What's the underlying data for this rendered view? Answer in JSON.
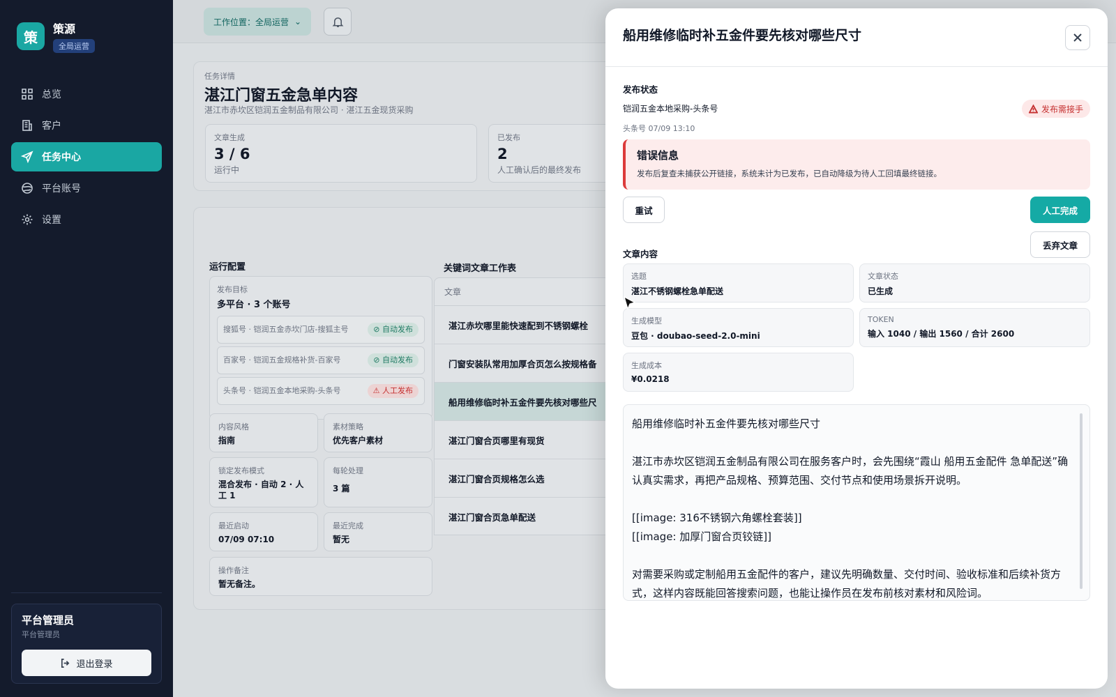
{
  "sidebar": {
    "brand_logo": "策",
    "brand_name": "策源",
    "brand_tag": "全局运营",
    "nav": [
      {
        "label": "总览",
        "icon": "grid-icon"
      },
      {
        "label": "客户",
        "icon": "building-icon"
      },
      {
        "label": "任务中心",
        "icon": "send-icon"
      },
      {
        "label": "平台账号",
        "icon": "globe-icon"
      },
      {
        "label": "设置",
        "icon": "gear-icon"
      }
    ],
    "user_name": "平台管理员",
    "user_role": "平台管理员",
    "logout": "退出登录"
  },
  "topbar": {
    "location": "工作位置：全局运营"
  },
  "detail": {
    "label": "任务详情",
    "title": "湛江门窗五金急单内容",
    "subtitle": "湛江市赤坎区铠润五金制品有限公司 · 湛江五金现货采购",
    "stats": [
      {
        "label": "文章生成",
        "value": "3 / 6",
        "note": "运行中"
      },
      {
        "label": "已发布",
        "value": "2",
        "note": "人工确认后的最终发布"
      }
    ]
  },
  "config": {
    "title": "运行配置",
    "target_label": "发布目标",
    "target_value": "多平台 · 3 个账号",
    "accounts": [
      {
        "name": "搜狐号 · 铠润五金赤坎门店-搜狐主号",
        "mode": "自动发布",
        "type": "auto"
      },
      {
        "name": "百家号 · 铠润五金规格补货-百家号",
        "mode": "自动发布",
        "type": "auto"
      },
      {
        "name": "头条号 · 铠润五金本地采购-头条号",
        "mode": "人工发布",
        "type": "manual"
      }
    ],
    "style_label": "内容风格",
    "style_value": "指南",
    "material_label": "素材策略",
    "material_value": "优先客户素材",
    "lock_label": "锁定发布模式",
    "lock_value": "混合发布 · 自动 2 · 人工 1",
    "batch_label": "每轮处理",
    "batch_value": "3 篇",
    "start_label": "最近启动",
    "start_value": "07/09 07:10",
    "finish_label": "最近完成",
    "finish_value": "暂无",
    "note_label": "操作备注",
    "note_value": "暂无备注。"
  },
  "keywords": {
    "title": "关键词文章工作表",
    "column": "文章",
    "rows": [
      "湛江赤坎哪里能快速配到不锈钢螺栓",
      "门窗安装队常用加厚合页怎么按规格备",
      "船用维修临时补五金件要先核对哪些尺",
      "湛江门窗合页哪里有现货",
      "湛江门窗合页规格怎么选",
      "湛江门窗合页急单配送"
    ]
  },
  "drawer": {
    "title": "船用维修临时补五金件要先核对哪些尺寸",
    "publish_section": "发布状态",
    "publish_account": "铠润五金本地采购-头条号",
    "publish_meta": "头条号   07/09 13:10",
    "warn_badge": "发布需接手",
    "error_title": "错误信息",
    "error_text": "发布后复查未捕获公开链接，系统未计为已发布，已自动降级为待人工回填最终链接。",
    "retry": "重试",
    "manual_done": "人工完成",
    "discard": "丢弃文章",
    "content_section": "文章内容",
    "info": [
      {
        "label": "选题",
        "value": "湛江不锈钢螺栓急单配送"
      },
      {
        "label": "文章状态",
        "value": "已生成"
      },
      {
        "label": "生成模型",
        "value": "豆包 · doubao-seed-2.0-mini"
      },
      {
        "label": "TOKEN",
        "value": "输入 1040 / 输出 1560 / 合计 2600"
      },
      {
        "label": "生成成本",
        "value": "¥0.0218"
      }
    ],
    "content_lines": [
      "船用维修临时补五金件要先核对哪些尺寸",
      "",
      "湛江市赤坎区铠润五金制品有限公司在服务客户时，会先围绕“霞山 船用五金配件 急单配送”确认真实需求，再把产品规格、预算范围、交付节点和使用场景拆开说明。",
      "",
      "[[image: 316不锈钢六角螺栓套装]]",
      "[[image: 加厚门窗合页铰链]]",
      "",
      "对需要采购或定制船用五金配件的客户，建议先明确数量、交付时间、验收标准和后续补货方式，这样内容既能回答搜索问题，也能让操作员在发布前核对素材和风险词。"
    ]
  },
  "colors": {
    "accent": "#1aa7a3",
    "sidebar_bg": "#141b2c",
    "error": "#dc3b3b"
  }
}
